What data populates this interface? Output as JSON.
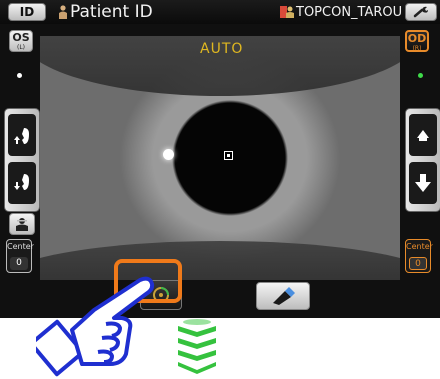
{
  "header": {
    "id_button": "ID",
    "patient_label": "Patient ID",
    "operator_label": "TOPCON_TAROU"
  },
  "camera": {
    "mode_label": "AUTO"
  },
  "left_controls": {
    "eye_button": "OS",
    "eye_button_sub": "(L)",
    "center_label": "Center",
    "center_value": "0"
  },
  "right_controls": {
    "eye_button": "OD",
    "eye_button_sub": "(R)",
    "center_label": "Center",
    "center_value": "0"
  },
  "colors": {
    "accent": "#f07a1a",
    "od_accent": "#e88b2a",
    "auto_text": "#e0b820",
    "status_dot_right": "#3fdb4a",
    "hand_blue": "#1f2fd0",
    "arrow_green": "#35c23e"
  },
  "icons": {
    "patient": "person-icon",
    "operator": "operator-icon",
    "tool": "wrench-icon",
    "chin_up": "chin-rest-up-icon",
    "chin_down": "chin-rest-down-icon",
    "head": "head-position-icon",
    "start": "start-measurement-icon",
    "clean": "cleaning-icon"
  }
}
